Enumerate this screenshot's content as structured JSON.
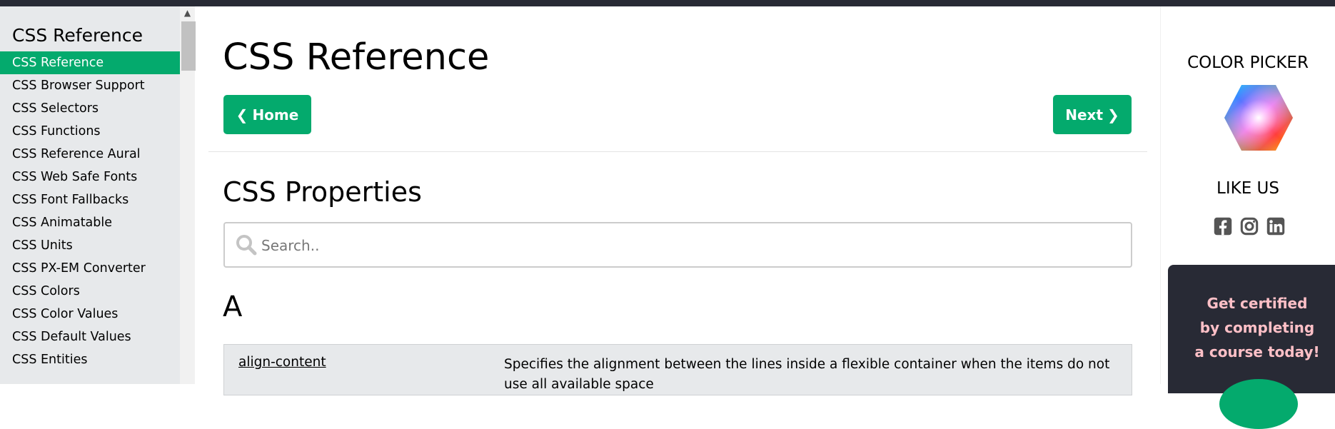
{
  "sidebar": {
    "title": "CSS Reference",
    "items": [
      {
        "label": "CSS Reference",
        "active": true
      },
      {
        "label": "CSS Browser Support"
      },
      {
        "label": "CSS Selectors"
      },
      {
        "label": "CSS Functions"
      },
      {
        "label": "CSS Reference Aural"
      },
      {
        "label": "CSS Web Safe Fonts"
      },
      {
        "label": "CSS Font Fallbacks"
      },
      {
        "label": "CSS Animatable"
      },
      {
        "label": "CSS Units"
      },
      {
        "label": "CSS PX-EM Converter"
      },
      {
        "label": "CSS Colors"
      },
      {
        "label": "CSS Color Values"
      },
      {
        "label": "CSS Default Values"
      },
      {
        "label": "CSS Entities"
      }
    ]
  },
  "main": {
    "title": "CSS Reference",
    "home_button": "Home",
    "next_button": "Next",
    "section_title": "CSS Properties",
    "search": {
      "placeholder": "Search..",
      "value": ""
    },
    "letter": "A",
    "properties": [
      {
        "name": "align-content",
        "description": "Specifies the alignment between the lines inside a flexible container when the items do not use all available space"
      }
    ]
  },
  "right": {
    "color_picker_heading": "COLOR PICKER",
    "like_us_heading": "LIKE US",
    "social_icons": [
      "facebook-icon",
      "instagram-icon",
      "linkedin-icon"
    ],
    "cert_lines": [
      "Get certified",
      "by completing",
      "a course today!"
    ]
  },
  "colors": {
    "accent": "#04aa6d",
    "topbar": "#282a35",
    "sidebar_bg": "#e7e9eb",
    "cert_text": "#ffc0c7"
  }
}
